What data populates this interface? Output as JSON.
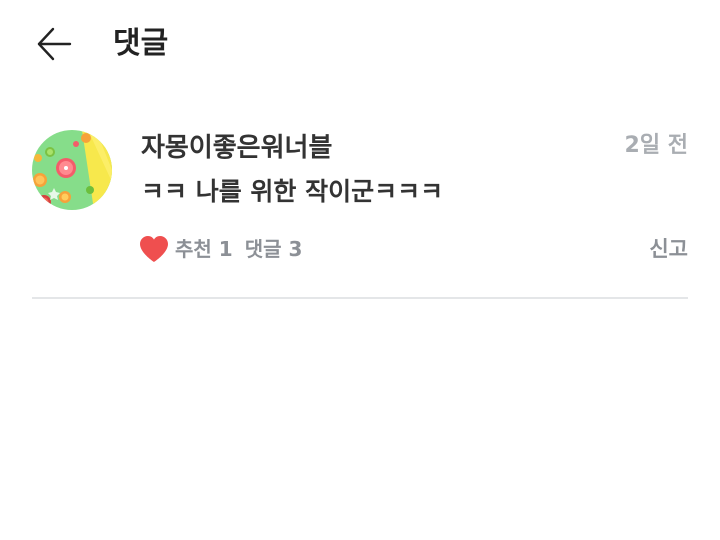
{
  "header": {
    "back_icon": "arrow-left-icon",
    "title": "댓글"
  },
  "comment": {
    "avatar_icon": "citrus-fruit-avatar",
    "username": "자몽이좋은워너블",
    "time": "2일 전",
    "text": "ㅋㅋ 나를 위한 작이군ㅋㅋㅋ",
    "like_icon": "heart-icon",
    "like_label": "추천 1",
    "reply_label": "댓글 3",
    "report_label": "신고"
  },
  "colors": {
    "heart": "#ef4f4f",
    "muted_text": "#8c9096",
    "time_text": "#a9adb2",
    "primary_text": "#333333",
    "divider": "#e4e6e8"
  }
}
